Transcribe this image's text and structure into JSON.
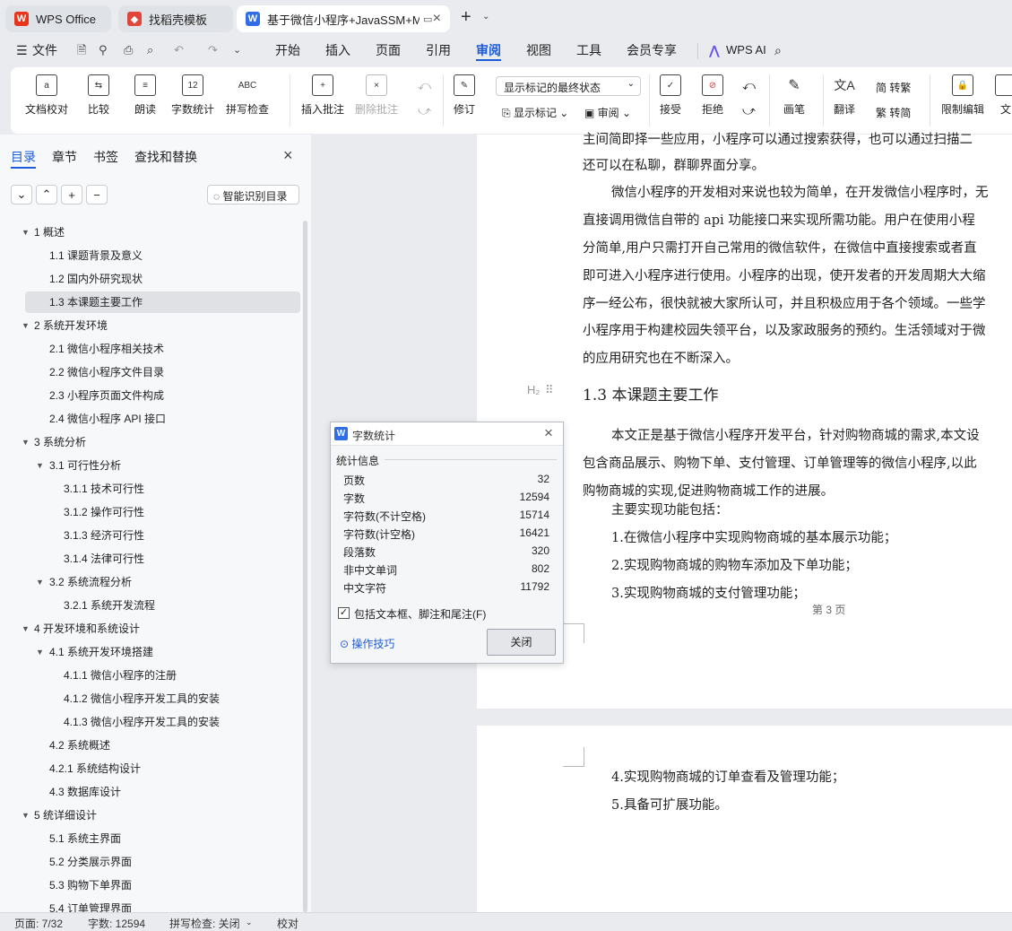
{
  "tabs": {
    "wps": "WPS Office",
    "daoke": "找稻壳模板",
    "doc": "基于微信小程序+JavaSSM+M",
    "new_tab": "+"
  },
  "menu": {
    "file": "文件",
    "items": [
      "开始",
      "插入",
      "页面",
      "引用",
      "审阅",
      "视图",
      "工具",
      "会员专享"
    ],
    "active": "审阅",
    "wps_ai": "WPS AI"
  },
  "ribbon": {
    "doc_check": "文档校对",
    "compare": "比较",
    "read_aloud": "朗读",
    "word_count": "字数统计",
    "spell_check": "拼写检查",
    "insert_comment": "插入批注",
    "delete_comment": "删除批注",
    "revise": "修订",
    "markup_select": "显示标记的最终状态",
    "show_markup": "显示标记",
    "review": "审阅",
    "accept": "接受",
    "reject": "拒绝",
    "pen": "画笔",
    "translate": "翻译",
    "to_traditional": "简 转繁",
    "to_simplified": "繁 转简",
    "restrict_edit": "限制编辑",
    "doc_edit": "文"
  },
  "sidebar": {
    "tabs": [
      "目录",
      "章节",
      "书签",
      "查找和替换"
    ],
    "smart_toc": "智能识别目录",
    "toc": [
      {
        "label": "1  概述",
        "level": 1,
        "arrow": true
      },
      {
        "label": "1.1 课题背景及意义",
        "level": 2
      },
      {
        "label": "1.2  国内外研究现状",
        "level": 2
      },
      {
        "label": "1.3  本课题主要工作",
        "level": 2,
        "selected": true
      },
      {
        "label": "2  系统开发环境",
        "level": 1,
        "arrow": true
      },
      {
        "label": "2.1 微信小程序相关技术",
        "level": 2
      },
      {
        "label": "2.2 微信小程序文件目录",
        "level": 2
      },
      {
        "label": "2.3 小程序页面文件构成",
        "level": 2
      },
      {
        "label": "2.4 微信小程序  API 接口",
        "level": 2
      },
      {
        "label": "3  系统分析",
        "level": 1,
        "arrow": true
      },
      {
        "label": "3.1  可行性分析",
        "level": 2,
        "arrow": true
      },
      {
        "label": "3.1.1  技术可行性",
        "level": 3
      },
      {
        "label": "3.1.2 操作可行性",
        "level": 3
      },
      {
        "label": "3.1.3  经济可行性",
        "level": 3
      },
      {
        "label": "3.1.4  法律可行性",
        "level": 3
      },
      {
        "label": "3.2 系统流程分析",
        "level": 2,
        "arrow": true
      },
      {
        "label": "3.2.1 系统开发流程",
        "level": 3
      },
      {
        "label": "4  开发环境和系统设计",
        "level": 1,
        "arrow": true
      },
      {
        "label": "4.1 系统开发环境搭建",
        "level": 2,
        "arrow": true
      },
      {
        "label": "4.1.1    微信小程序的注册",
        "level": 3
      },
      {
        "label": "4.1.2  微信小程序开发工具的安装",
        "level": 3
      },
      {
        "label": "4.1.3  微信小程序开发工具的安装",
        "level": 3
      },
      {
        "label": "4.2  系统概述",
        "level": 2
      },
      {
        "label": "4.2.1  系统结构设计",
        "level": 2
      },
      {
        "label": "4.3 数据库设计",
        "level": 2
      },
      {
        "label": "5 统详细设计",
        "level": 1,
        "arrow": true
      },
      {
        "label": "5.1 系统主界面",
        "level": 2
      },
      {
        "label": "5.2 分类展示界面",
        "level": 2
      },
      {
        "label": "5.3 购物下单界面",
        "level": 2
      },
      {
        "label": "5.4 订单管理界面",
        "level": 2
      }
    ]
  },
  "document": {
    "page1_lines": [
      "主间简即择一些应用，小程序可以通过搜索获得，也可以通过扫描二",
      "还可以在私聊，群聊界面分享。",
      "微信小程序的开发相对来说也较为简单，在开发微信小程序时，无",
      "直接调用微信自带的  api  功能接口来实现所需功能。用户在使用小程",
      "分简单,用户只需打开自己常用的微信软件，在微信中直接搜索或者直",
      "即可进入小程序进行使用。小程序的出现，使开发者的开发周期大大缩",
      "序一经公布，很快就被大家所认可，并且积极应用于各个领域。一些学",
      "小程序用于构建校园失领平台，以及家政服务的预约。生活领域对于微",
      "的应用研究也在不断深入。"
    ],
    "heading_marker": "H₂",
    "heading": "1.3  本课题主要工作",
    "page1_lines2": [
      "本文正是基于微信小程序开发平台，针对购物商城的需求,本文设",
      "包含商品展示、购物下单、支付管理、订单管理等的微信小程序,以此",
      "购物商城的实现,促进购物商城工作的进展。",
      "主要实现功能包括：",
      "1.在微信小程序中实现购物商城的基本展示功能；",
      "2.实现购物商城的购物车添加及下单功能；",
      "3.实现购物商城的支付管理功能；"
    ],
    "page_label": "第 3 页",
    "page2_lines": [
      "4.实现购物商城的订单查看及管理功能；",
      "5.具备可扩展功能。"
    ]
  },
  "dialog": {
    "title": "字数统计",
    "section": "统计信息",
    "rows": [
      {
        "label": "页数",
        "value": "32"
      },
      {
        "label": "字数",
        "value": "12594"
      },
      {
        "label": "字符数(不计空格)",
        "value": "15714"
      },
      {
        "label": "字符数(计空格)",
        "value": "16421"
      },
      {
        "label": "段落数",
        "value": "320"
      },
      {
        "label": "非中文单词",
        "value": "802"
      },
      {
        "label": "中文字符",
        "value": "11792"
      }
    ],
    "include_checkbox": "包括文本框、脚注和尾注(F)",
    "include_checked": true,
    "tips": "操作技巧",
    "close_button": "关闭"
  },
  "status": {
    "page": "页面: 7/32",
    "words": "字数: 12594",
    "spell": "拼写检查: 关闭",
    "proof": "校对"
  },
  "colors": {
    "accent": "#1c5cd8",
    "wps_red": "#e8341c",
    "daoke_red": "#e0463a",
    "doc_blue": "#2f6ee6"
  }
}
